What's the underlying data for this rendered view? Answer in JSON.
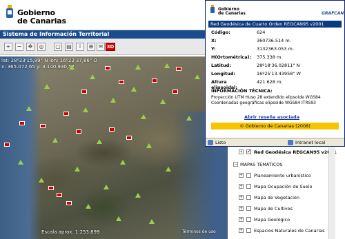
{
  "header": {
    "brand_line1": "Gobierno",
    "brand_line2": "de Canarias",
    "app_title": "Sistema de Información Territorial"
  },
  "toolbar": {
    "buttons": [
      "zoom-in",
      "zoom-out",
      "pan",
      "info",
      "print",
      "measure",
      "layers",
      "help",
      "email"
    ],
    "three_d_label": "3D"
  },
  "map": {
    "coord_line1": "lat: 28º23'15,99\" N  lon: 16º22'37,86\" O",
    "coord_line2": "x: 365.072,65  y: 3.140.930,57",
    "scale_text": "Escala aprox. 1:253.899",
    "terms_text": "Términos de uso"
  },
  "popup": {
    "brand_line1": "Gobierno",
    "brand_line2": "de Canarias",
    "grafcan": "GRAFCAN",
    "title": "Red Geodésica de Cuarto Orden REGCAN95 v2001",
    "fields": [
      {
        "label": "Código:",
        "value": "624"
      },
      {
        "label": "X:",
        "value": "360736.514 m."
      },
      {
        "label": "Y:",
        "value": "3132363.053 m."
      },
      {
        "label": "H(Ortométrica):",
        "value": "375.338 m."
      },
      {
        "label": "Latitud:",
        "value": "28º18'36.02811\" N"
      },
      {
        "label": "Longitud:",
        "value": "16º25'13.43958\" W"
      },
      {
        "label": "Altura elipsoidal:",
        "value": "421.628 m."
      }
    ],
    "info_title": "INFORMACIÓN TÉCNICA:",
    "info_line1": "Proyección UTM Huso 28 extendido elipsoide WGS84",
    "info_line2": "Coordenadas geográficas elipsoide WGS84 ITRS93",
    "link_text": "Abrir reseña asociada",
    "copyright": "© Gobierno de Canarias (2008)",
    "status_done": "Listo",
    "status_zone": "Intranet local"
  },
  "tree": {
    "items": [
      {
        "label": "Red Geodésica REGCAN95 v2001",
        "checked": true
      },
      {
        "label": "MAPAS TEMÁTICOS",
        "checked": false
      },
      {
        "label": "Planeamiento urbanístico",
        "checked": false
      },
      {
        "label": "Mapa Ocupación de Suelo",
        "checked": false
      },
      {
        "label": "Mapa de Vegetación",
        "checked": false
      },
      {
        "label": "Mapa de Cultivos",
        "checked": false
      },
      {
        "label": "Mapa Geológico",
        "checked": false
      },
      {
        "label": "Espacios Naturales de Canarias",
        "checked": false
      }
    ]
  },
  "colors": {
    "titlebar": "#1b4d8e",
    "marker_red": "#cc0000",
    "triangle_green": "#9ad04b",
    "copyright_yellow": "#f6c500"
  }
}
